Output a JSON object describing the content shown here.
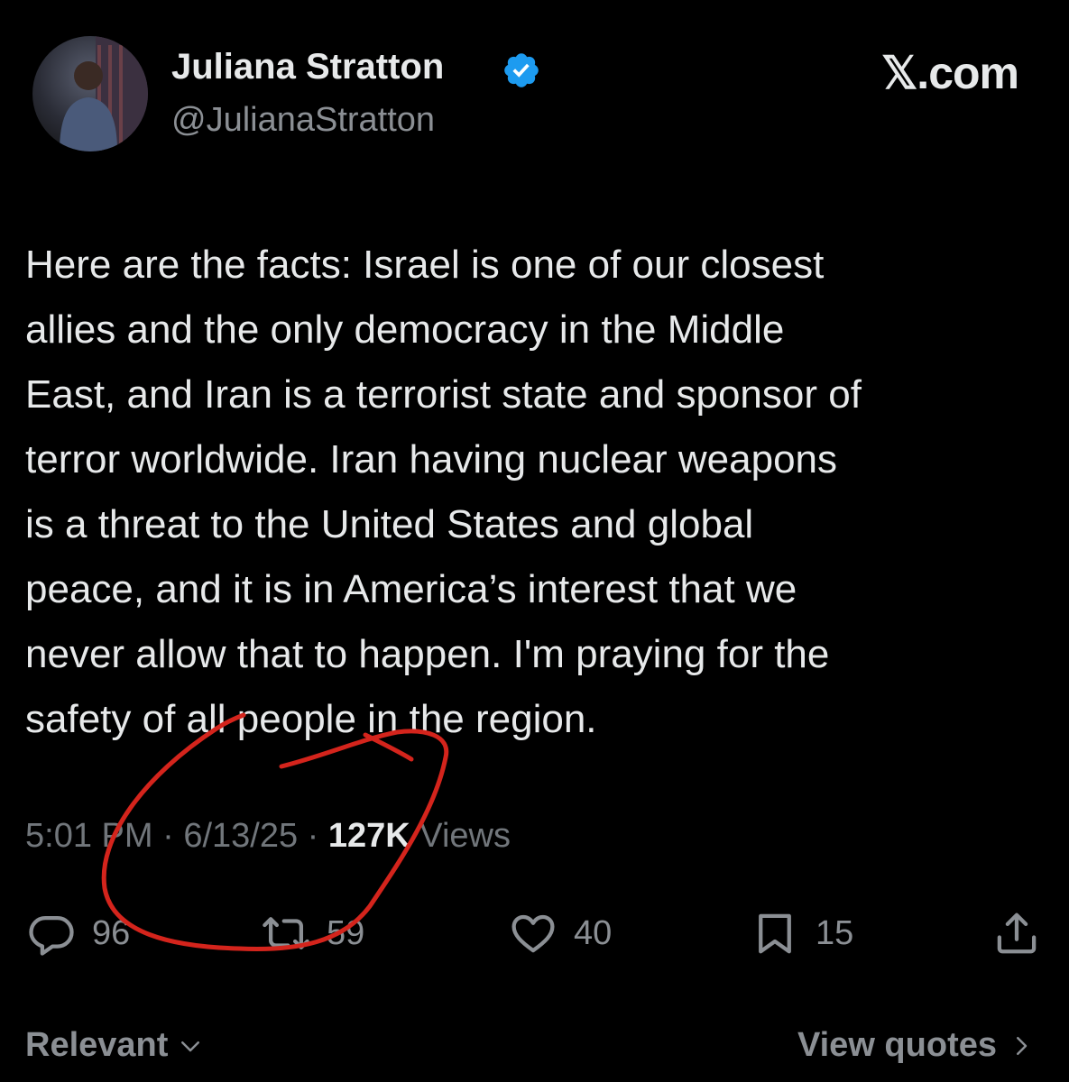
{
  "author": {
    "display_name": "Juliana Stratton",
    "handle": "@JulianaStratton",
    "verified": true,
    "verified_icon": "verified-badge-icon",
    "accent_color": "#1d9bf0"
  },
  "brand": {
    "label": "𝕏.com"
  },
  "tweet": {
    "text": "Here are the facts: Israel is one of our closest\nallies and the only democracy in the Middle\nEast, and Iran is a terrorist state and sponsor of\nterror worldwide. Iran having nuclear weapons\nis a threat to the United States and global\npeace, and it is in America’s interest that we\nnever allow that to happen. I'm praying for the\nsafety of all people in the region.",
    "time": "5:01 PM",
    "separator": "·",
    "date": "6/13/25",
    "views_count": "127K",
    "views_label": "Views"
  },
  "actions": {
    "replies": {
      "icon": "reply-icon",
      "count": "96"
    },
    "reposts": {
      "icon": "repost-icon",
      "count": "59"
    },
    "likes": {
      "icon": "heart-icon",
      "count": "40"
    },
    "bookmarks": {
      "icon": "bookmark-icon",
      "count": "15"
    },
    "share": {
      "icon": "share-icon"
    }
  },
  "footer": {
    "sort_label": "Relevant",
    "view_quotes_label": "View quotes"
  },
  "annotation": {
    "color": "#d4241c"
  }
}
